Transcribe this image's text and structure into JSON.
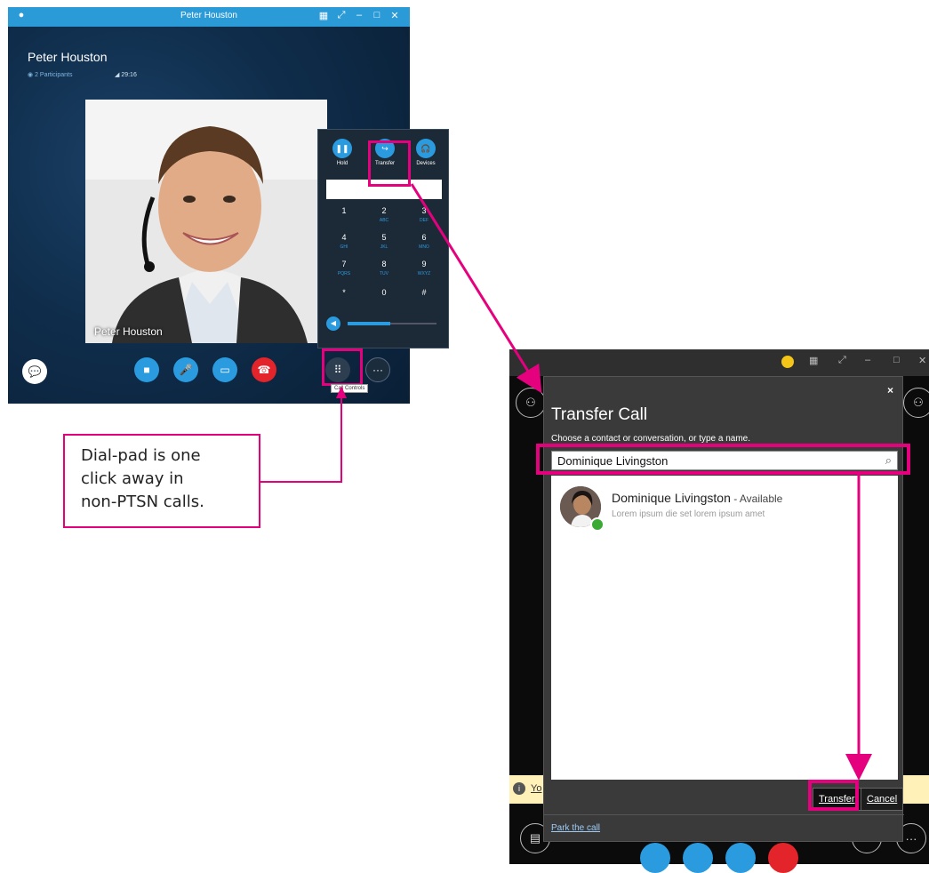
{
  "call_window": {
    "title": "Peter Houston",
    "caller_name": "Peter Houston",
    "participants": "2 Participants",
    "timer": "29:16",
    "video_label": "Peter Houston",
    "dialpad": {
      "actions": [
        "Hold",
        "Transfer",
        "Devices"
      ],
      "keys": [
        {
          "d": "1",
          "l": ""
        },
        {
          "d": "2",
          "l": "ABC"
        },
        {
          "d": "3",
          "l": "DEF"
        },
        {
          "d": "4",
          "l": "GHI"
        },
        {
          "d": "5",
          "l": "JKL"
        },
        {
          "d": "6",
          "l": "MNO"
        },
        {
          "d": "7",
          "l": "PQRS"
        },
        {
          "d": "8",
          "l": "TUV"
        },
        {
          "d": "9",
          "l": "WXYZ"
        },
        {
          "d": "*",
          "l": ""
        },
        {
          "d": "0",
          "l": ""
        },
        {
          "d": "#",
          "l": ""
        }
      ]
    },
    "tooltip": "Call Controls"
  },
  "callout": {
    "lines": [
      "Dial-pad is one",
      "click away in",
      "non-PTSN calls."
    ]
  },
  "transfer_dialog": {
    "title": "Transfer Call",
    "instruction": "Choose a contact or conversation, or type a name.",
    "search_value": "Dominique Livingston",
    "contact": {
      "name": "Dominique Livingston",
      "status": " - Available",
      "note": "Lorem ipsum die set lorem ipsum amet"
    },
    "transfer_label": "Transfer",
    "cancel_label": "Cancel",
    "park_label": "Park the call",
    "close_label": "×"
  },
  "background_window": {
    "banner_text": "Yo"
  },
  "colors": {
    "accent": "#e5007e",
    "skype_blue": "#2b9be0",
    "hangup_red": "#e3242b"
  }
}
